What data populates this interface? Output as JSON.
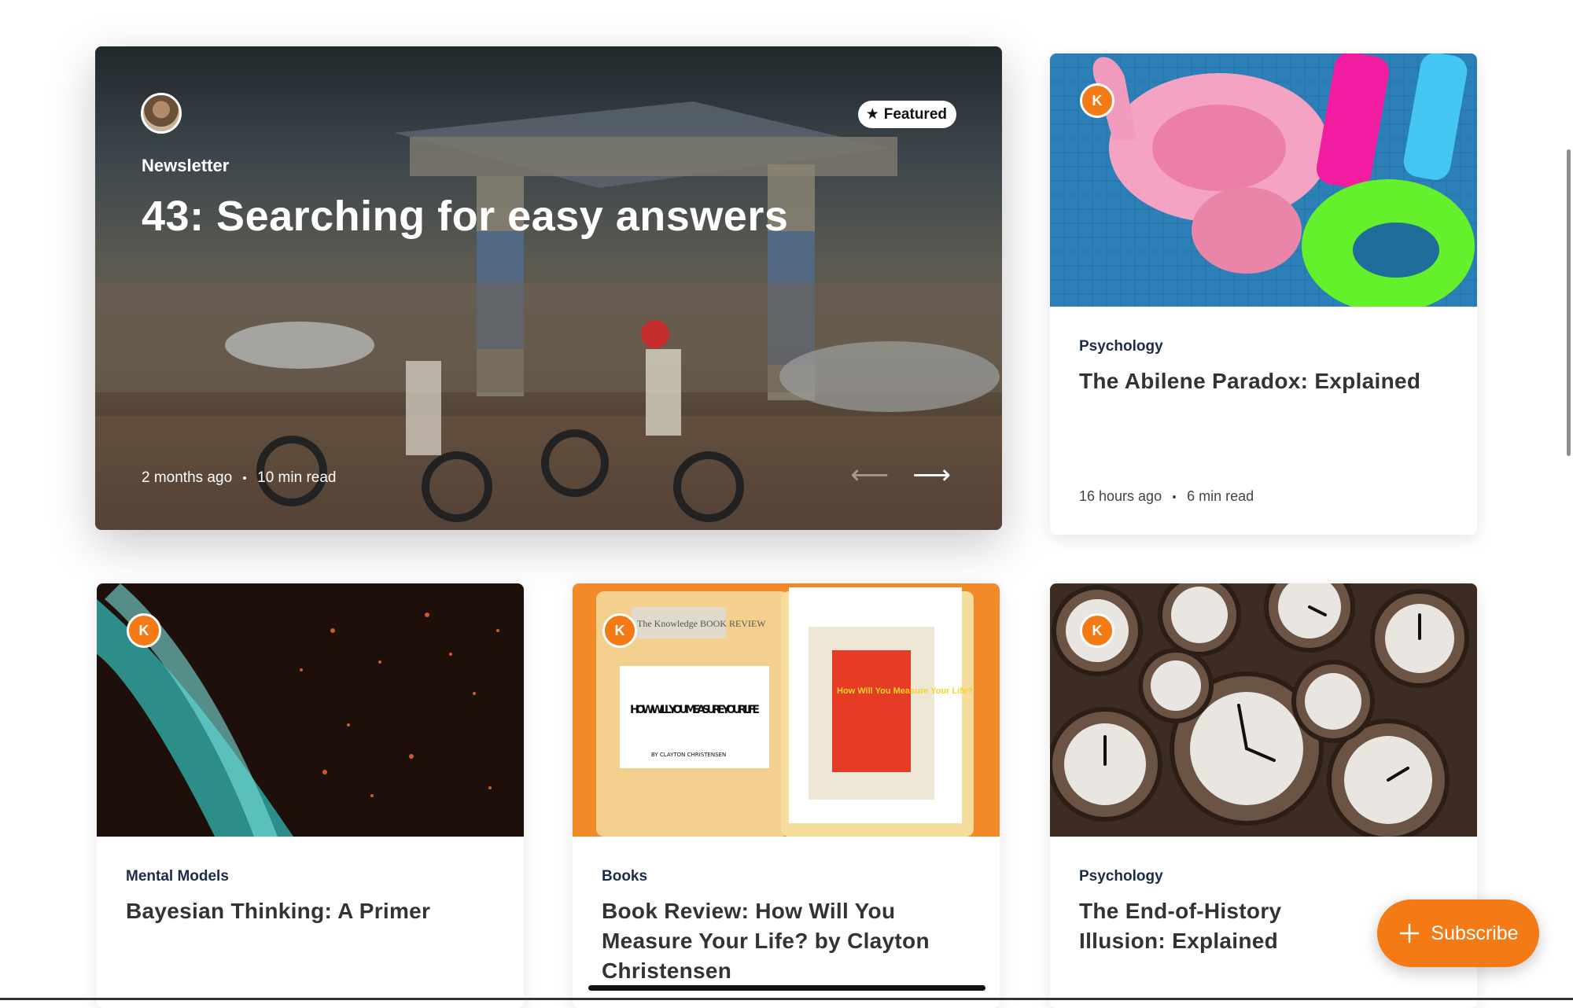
{
  "featured": {
    "badge": "Featured",
    "category": "Newsletter",
    "title": "43: Searching for easy answers",
    "meta": {
      "published": "2 months ago",
      "read_time": "10 min read"
    }
  },
  "cards": [
    {
      "avatar_letter": "K",
      "category": "Psychology",
      "title": "The Abilene Paradox: Explained",
      "published": "16 hours ago",
      "read_time": "6 min read"
    },
    {
      "avatar_letter": "K",
      "category": "Mental Models",
      "title": "Bayesian Thinking: A Primer"
    },
    {
      "avatar_letter": "K",
      "category": "Books",
      "title": "Book Review: How Will You Measure Your Life? by Clayton Christensen",
      "art": {
        "tag_text": "The Knowledge BOOK REVIEW",
        "note_title": "HOW WILL YOU MEASURE YOUR LIFE",
        "note_author": "BY CLAYTON CHRISTENSEN",
        "cover_title": "How Will You Measure Your Life?"
      }
    },
    {
      "avatar_letter": "K",
      "category": "Psychology",
      "title": "The End-of-History Illusion: Explained"
    }
  ],
  "subscribe_label": "Subscribe",
  "colors": {
    "accent": "#f47a16",
    "category_text": "#1c2b49"
  }
}
